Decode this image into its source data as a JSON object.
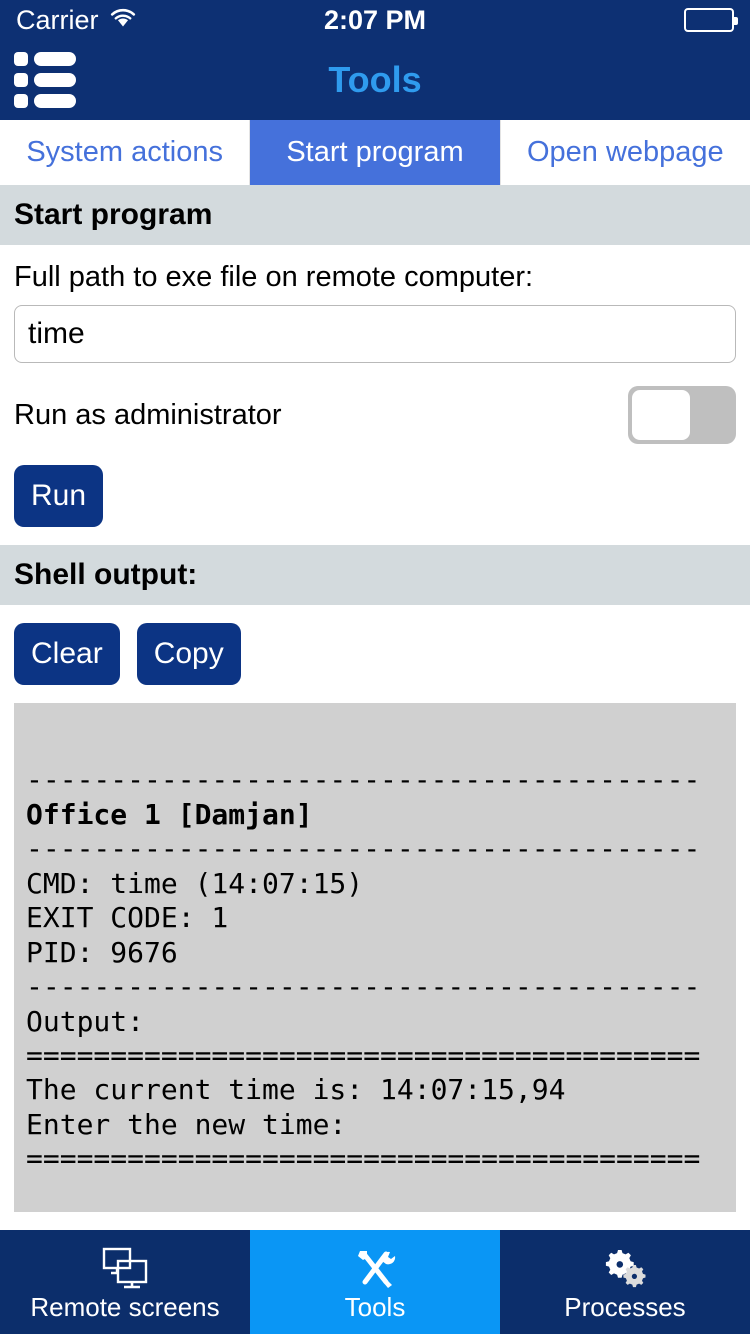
{
  "status_bar": {
    "carrier": "Carrier",
    "wifi_icon": "wifi-icon",
    "time": "2:07 PM",
    "battery_icon": "battery-full-icon"
  },
  "nav_bar": {
    "menu_icon": "list-menu-icon",
    "title": "Tools"
  },
  "tabs": [
    {
      "label": "System actions",
      "active": false
    },
    {
      "label": "Start program",
      "active": true
    },
    {
      "label": "Open webpage",
      "active": false
    }
  ],
  "sections": {
    "start_program_header": "Start program",
    "shell_output_header": "Shell output:"
  },
  "form": {
    "path_label": "Full path to exe file on remote computer:",
    "path_value": "time",
    "path_placeholder": "",
    "admin_label": "Run as administrator",
    "admin_toggle_state": "off",
    "run_label": "Run"
  },
  "output_actions": {
    "clear_label": "Clear",
    "copy_label": "Copy"
  },
  "shell_output": {
    "lines": [
      {
        "text": "",
        "bold": false
      },
      {
        "text": "----------------------------------------",
        "bold": false
      },
      {
        "text": "Office 1 [Damjan]",
        "bold": true
      },
      {
        "text": "----------------------------------------",
        "bold": false
      },
      {
        "text": "CMD: time (14:07:15)",
        "bold": false
      },
      {
        "text": "EXIT CODE: 1",
        "bold": false
      },
      {
        "text": "PID: 9676",
        "bold": false
      },
      {
        "text": "----------------------------------------",
        "bold": false
      },
      {
        "text": "Output:",
        "bold": false
      },
      {
        "text": "========================================",
        "bold": false
      },
      {
        "text": "The current time is: 14:07:15,94",
        "bold": false
      },
      {
        "text": "Enter the new time:",
        "bold": false
      },
      {
        "text": "========================================",
        "bold": false
      }
    ]
  },
  "bottom_tabs": [
    {
      "label": "Remote screens",
      "icon": "monitors-icon",
      "active": false
    },
    {
      "label": "Tools",
      "icon": "hammer-wrench-icon",
      "active": true
    },
    {
      "label": "Processes",
      "icon": "gears-icon",
      "active": false
    }
  ],
  "colors": {
    "navy": "#0D3073",
    "tab_active_blue": "#4571DB",
    "tab_link_blue": "#4571DB",
    "title_blue": "#2F9BEE",
    "button_navy": "#0C3484",
    "section_gray": "#D3DADD",
    "shell_gray": "#D0D0D0",
    "tabbar_navy": "#0C2E6B",
    "tabbar_active_blue": "#0A96F5"
  }
}
